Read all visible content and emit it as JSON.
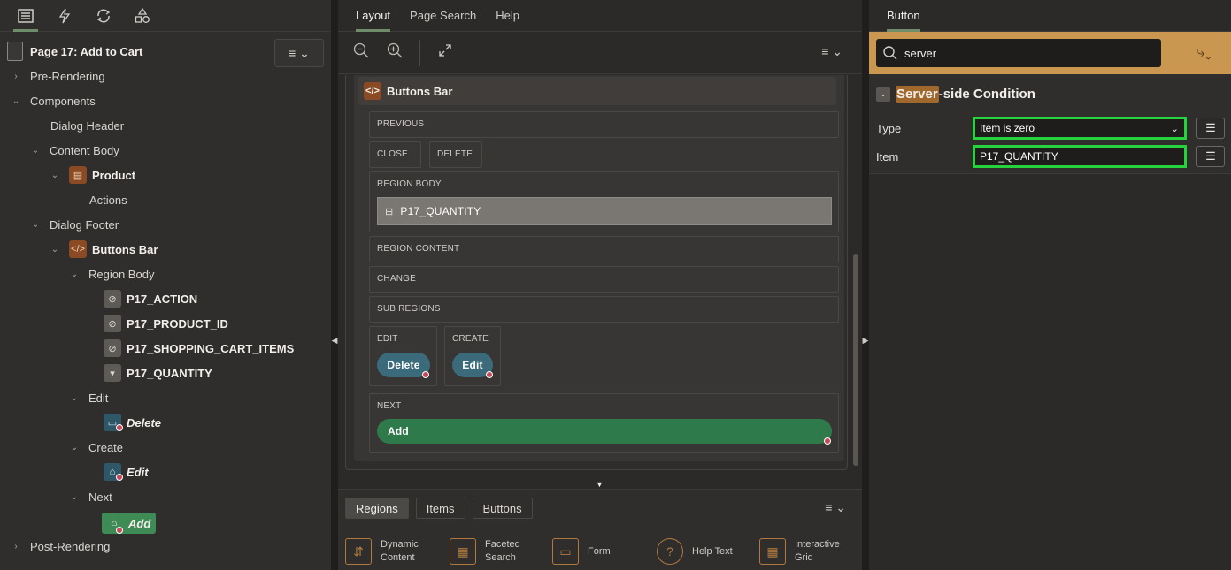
{
  "left_panel": {
    "tabs": [
      "rendering-icon",
      "dynamic-actions-icon",
      "processing-icon",
      "shared-components-icon"
    ],
    "page_title": "Page 17: Add to Cart",
    "menu_icon": "≡ ⌄",
    "tree": {
      "pre_rendering": "Pre-Rendering",
      "components": "Components",
      "dialog_header": "Dialog Header",
      "content_body": "Content Body",
      "product": "Product",
      "actions": "Actions",
      "dialog_footer": "Dialog Footer",
      "buttons_bar": "Buttons Bar",
      "region_body": "Region Body",
      "p17_action": "P17_ACTION",
      "p17_product_id": "P17_PRODUCT_ID",
      "p17_shopping_cart_items": "P17_SHOPPING_CART_ITEMS",
      "p17_quantity": "P17_QUANTITY",
      "edit": "Edit",
      "delete": "Delete",
      "create": "Create",
      "edit_button": "Edit",
      "next": "Next",
      "add": "Add",
      "post_rendering": "Post-Rendering"
    }
  },
  "center_panel": {
    "tabs": [
      "Layout",
      "Page Search",
      "Help"
    ],
    "active_tab": "Layout",
    "region_title": "Buttons Bar",
    "slots": {
      "previous": "PREVIOUS",
      "close": "CLOSE",
      "delete": "DELETE",
      "region_body": "REGION BODY",
      "quantity_item": "P17_QUANTITY",
      "region_content": "REGION CONTENT",
      "change": "CHANGE",
      "sub_regions": "SUB REGIONS",
      "edit": "EDIT",
      "create": "CREATE",
      "next": "NEXT"
    },
    "buttons": {
      "delete": "Delete",
      "edit": "Edit",
      "add": "Add"
    },
    "gallery": {
      "tabs": [
        "Regions",
        "Items",
        "Buttons"
      ],
      "active_tab": "Regions",
      "items": [
        {
          "label": "Dynamic\nContent",
          "icon": "dynamic-content-icon"
        },
        {
          "label": "Faceted\nSearch",
          "icon": "faceted-search-icon"
        },
        {
          "label": "Form",
          "icon": "form-icon"
        },
        {
          "label": "Help Text",
          "icon": "help-text-icon"
        },
        {
          "label": "Interactive\nGrid",
          "icon": "interactive-grid-icon"
        }
      ]
    }
  },
  "right_panel": {
    "tab": "Button",
    "search": {
      "value": "server"
    },
    "section_title_highlight": "Server",
    "section_title_rest": "-side Condition",
    "type_label": "Type",
    "type_value": "Item is zero",
    "item_label": "Item",
    "item_value": "P17_QUANTITY"
  },
  "colors": {
    "accent_green": "#27d23f",
    "search_band": "#c9974f",
    "add_button": "#2f7a4a",
    "delete_button": "#3b6a7a"
  }
}
